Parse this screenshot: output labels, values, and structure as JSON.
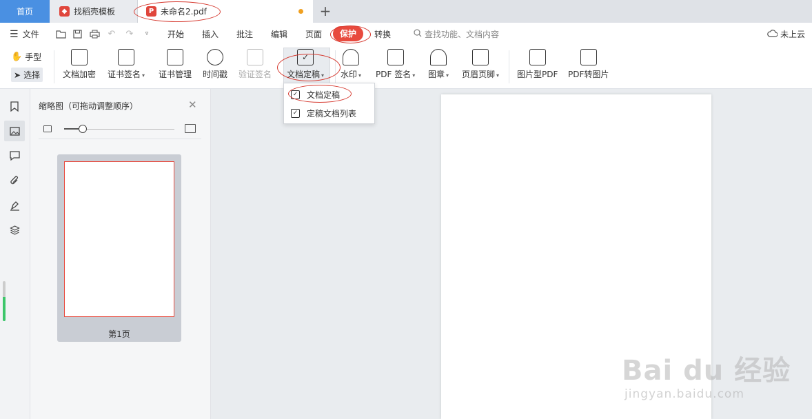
{
  "tabs": {
    "home": "首页",
    "template": "找稻壳模板",
    "document": "未命名2.pdf",
    "add": "+"
  },
  "menu": {
    "file": "文件",
    "items": [
      "开始",
      "插入",
      "批注",
      "编辑",
      "页面",
      "保护",
      "转换"
    ],
    "search_placeholder": "查找功能、文档内容",
    "cloud": "未上云"
  },
  "ribbon": {
    "hand": "手型",
    "select": "选择",
    "tools": [
      {
        "label": "文档加密",
        "icon": "doc-encrypt-icon"
      },
      {
        "label": "证书签名",
        "icon": "certificate-sign-icon"
      },
      {
        "label": "证书管理",
        "icon": "certificate-manage-icon"
      },
      {
        "label": "时间戳",
        "icon": "timestamp-icon"
      },
      {
        "label": "验证签名",
        "icon": "verify-sign-icon"
      },
      {
        "label": "文档定稿",
        "icon": "finalize-icon"
      },
      {
        "label": "水印",
        "icon": "watermark-icon"
      },
      {
        "label": "PDF 签名",
        "icon": "pdf-sign-icon"
      },
      {
        "label": "图章",
        "icon": "stamp-icon"
      },
      {
        "label": "页眉页脚",
        "icon": "header-footer-icon"
      },
      {
        "label": "图片型PDF",
        "icon": "image-pdf-icon"
      },
      {
        "label": "PDF转图片",
        "icon": "pdf-to-image-icon"
      }
    ]
  },
  "dropdown": {
    "items": [
      "文档定稿",
      "定稿文档列表"
    ]
  },
  "thumbnail_panel": {
    "title": "缩略图（可拖动调整顺序）",
    "page_label": "第1页",
    "zoom_level": 0.17
  },
  "watermark": {
    "brand": "Bai du 经验",
    "url": "jingyan.baidu.com"
  },
  "colors": {
    "accent_blue": "#4a90e2",
    "protect_red": "#e84a3e",
    "scroll_green": "#3dc66a"
  }
}
